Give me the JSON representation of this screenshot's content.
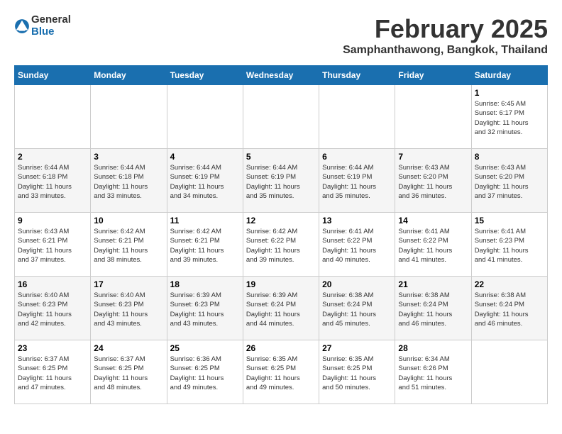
{
  "header": {
    "logo_general": "General",
    "logo_blue": "Blue",
    "title": "February 2025",
    "subtitle": "Samphanthawong, Bangkok, Thailand"
  },
  "weekdays": [
    "Sunday",
    "Monday",
    "Tuesday",
    "Wednesday",
    "Thursday",
    "Friday",
    "Saturday"
  ],
  "weeks": [
    [
      {
        "day": "",
        "info": ""
      },
      {
        "day": "",
        "info": ""
      },
      {
        "day": "",
        "info": ""
      },
      {
        "day": "",
        "info": ""
      },
      {
        "day": "",
        "info": ""
      },
      {
        "day": "",
        "info": ""
      },
      {
        "day": "1",
        "info": "Sunrise: 6:45 AM\nSunset: 6:17 PM\nDaylight: 11 hours\nand 32 minutes."
      }
    ],
    [
      {
        "day": "2",
        "info": "Sunrise: 6:44 AM\nSunset: 6:18 PM\nDaylight: 11 hours\nand 33 minutes."
      },
      {
        "day": "3",
        "info": "Sunrise: 6:44 AM\nSunset: 6:18 PM\nDaylight: 11 hours\nand 33 minutes."
      },
      {
        "day": "4",
        "info": "Sunrise: 6:44 AM\nSunset: 6:19 PM\nDaylight: 11 hours\nand 34 minutes."
      },
      {
        "day": "5",
        "info": "Sunrise: 6:44 AM\nSunset: 6:19 PM\nDaylight: 11 hours\nand 35 minutes."
      },
      {
        "day": "6",
        "info": "Sunrise: 6:44 AM\nSunset: 6:19 PM\nDaylight: 11 hours\nand 35 minutes."
      },
      {
        "day": "7",
        "info": "Sunrise: 6:43 AM\nSunset: 6:20 PM\nDaylight: 11 hours\nand 36 minutes."
      },
      {
        "day": "8",
        "info": "Sunrise: 6:43 AM\nSunset: 6:20 PM\nDaylight: 11 hours\nand 37 minutes."
      }
    ],
    [
      {
        "day": "9",
        "info": "Sunrise: 6:43 AM\nSunset: 6:21 PM\nDaylight: 11 hours\nand 37 minutes."
      },
      {
        "day": "10",
        "info": "Sunrise: 6:42 AM\nSunset: 6:21 PM\nDaylight: 11 hours\nand 38 minutes."
      },
      {
        "day": "11",
        "info": "Sunrise: 6:42 AM\nSunset: 6:21 PM\nDaylight: 11 hours\nand 39 minutes."
      },
      {
        "day": "12",
        "info": "Sunrise: 6:42 AM\nSunset: 6:22 PM\nDaylight: 11 hours\nand 39 minutes."
      },
      {
        "day": "13",
        "info": "Sunrise: 6:41 AM\nSunset: 6:22 PM\nDaylight: 11 hours\nand 40 minutes."
      },
      {
        "day": "14",
        "info": "Sunrise: 6:41 AM\nSunset: 6:22 PM\nDaylight: 11 hours\nand 41 minutes."
      },
      {
        "day": "15",
        "info": "Sunrise: 6:41 AM\nSunset: 6:23 PM\nDaylight: 11 hours\nand 41 minutes."
      }
    ],
    [
      {
        "day": "16",
        "info": "Sunrise: 6:40 AM\nSunset: 6:23 PM\nDaylight: 11 hours\nand 42 minutes."
      },
      {
        "day": "17",
        "info": "Sunrise: 6:40 AM\nSunset: 6:23 PM\nDaylight: 11 hours\nand 43 minutes."
      },
      {
        "day": "18",
        "info": "Sunrise: 6:39 AM\nSunset: 6:23 PM\nDaylight: 11 hours\nand 43 minutes."
      },
      {
        "day": "19",
        "info": "Sunrise: 6:39 AM\nSunset: 6:24 PM\nDaylight: 11 hours\nand 44 minutes."
      },
      {
        "day": "20",
        "info": "Sunrise: 6:38 AM\nSunset: 6:24 PM\nDaylight: 11 hours\nand 45 minutes."
      },
      {
        "day": "21",
        "info": "Sunrise: 6:38 AM\nSunset: 6:24 PM\nDaylight: 11 hours\nand 46 minutes."
      },
      {
        "day": "22",
        "info": "Sunrise: 6:38 AM\nSunset: 6:24 PM\nDaylight: 11 hours\nand 46 minutes."
      }
    ],
    [
      {
        "day": "23",
        "info": "Sunrise: 6:37 AM\nSunset: 6:25 PM\nDaylight: 11 hours\nand 47 minutes."
      },
      {
        "day": "24",
        "info": "Sunrise: 6:37 AM\nSunset: 6:25 PM\nDaylight: 11 hours\nand 48 minutes."
      },
      {
        "day": "25",
        "info": "Sunrise: 6:36 AM\nSunset: 6:25 PM\nDaylight: 11 hours\nand 49 minutes."
      },
      {
        "day": "26",
        "info": "Sunrise: 6:35 AM\nSunset: 6:25 PM\nDaylight: 11 hours\nand 49 minutes."
      },
      {
        "day": "27",
        "info": "Sunrise: 6:35 AM\nSunset: 6:25 PM\nDaylight: 11 hours\nand 50 minutes."
      },
      {
        "day": "28",
        "info": "Sunrise: 6:34 AM\nSunset: 6:26 PM\nDaylight: 11 hours\nand 51 minutes."
      },
      {
        "day": "",
        "info": ""
      }
    ]
  ]
}
